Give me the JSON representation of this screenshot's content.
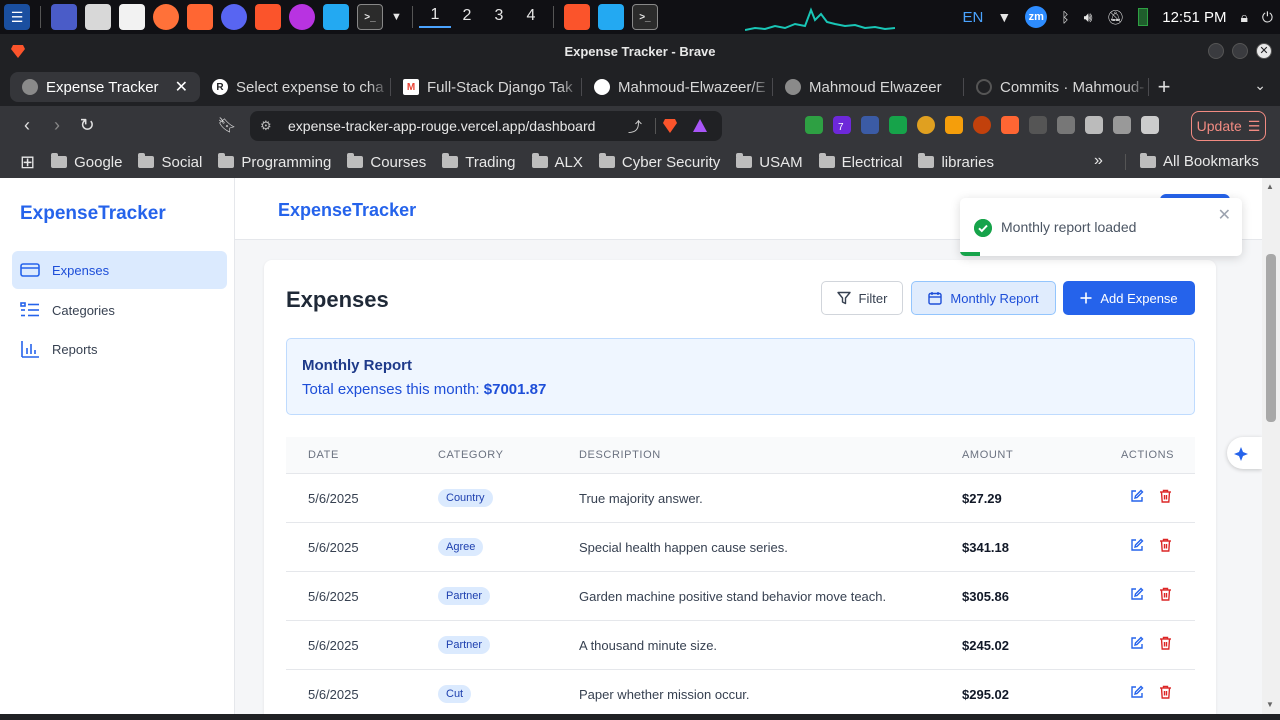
{
  "taskbar": {
    "workspaces": [
      "1",
      "2",
      "3",
      "4"
    ],
    "active_workspace": "1",
    "language": "EN",
    "zoom_label": "zm",
    "clock": "12:51 PM"
  },
  "browser": {
    "window_title": "Expense Tracker - Brave",
    "tabs": [
      {
        "label": "Expense Tracker",
        "active": true
      },
      {
        "label": "Select expense to cha"
      },
      {
        "label": "Full-Stack Django Tak"
      },
      {
        "label": "Mahmoud-Elwazeer/E"
      },
      {
        "label": "Mahmoud Elwazeer"
      },
      {
        "label": "Commits · Mahmoud-"
      }
    ],
    "url": "expense-tracker-app-rouge.vercel.app/dashboard",
    "update_label": "Update",
    "extension_badge": "7",
    "bookmarks": [
      "Google",
      "Social",
      "Programming",
      "Courses",
      "Trading",
      "ALX",
      "Cyber Security",
      "USAM",
      "Electrical",
      "libraries"
    ],
    "bookmarks_more": "»",
    "all_bookmarks": "All Bookmarks"
  },
  "sidebar": {
    "brand": "ExpenseTracker",
    "items": [
      {
        "label": "Expenses",
        "active": true
      },
      {
        "label": "Categories"
      },
      {
        "label": "Reports"
      }
    ]
  },
  "header": {
    "brand": "ExpenseTracker"
  },
  "main": {
    "title": "Expenses",
    "filter_label": "Filter",
    "monthly_report_label": "Monthly Report",
    "add_expense_label": "Add Expense",
    "report": {
      "title": "Monthly Report",
      "label": "Total expenses this month:",
      "value": "$7001.87"
    },
    "table": {
      "headers": [
        "DATE",
        "CATEGORY",
        "DESCRIPTION",
        "AMOUNT",
        "ACTIONS"
      ],
      "rows": [
        {
          "date": "5/6/2025",
          "category": "Country",
          "description": "True majority answer.",
          "amount": "$27.29"
        },
        {
          "date": "5/6/2025",
          "category": "Agree",
          "description": "Special health happen cause series.",
          "amount": "$341.18"
        },
        {
          "date": "5/6/2025",
          "category": "Partner",
          "description": "Garden machine positive stand behavior move teach.",
          "amount": "$305.86"
        },
        {
          "date": "5/6/2025",
          "category": "Partner",
          "description": "A thousand minute size.",
          "amount": "$245.02"
        },
        {
          "date": "5/6/2025",
          "category": "Cut",
          "description": "Paper whether mission occur.",
          "amount": "$295.02"
        }
      ]
    }
  },
  "toast": {
    "message": "Monthly report loaded",
    "progress": 0.07
  },
  "colors": {
    "accent": "#2563eb",
    "success": "#16a34a",
    "danger": "#dc2626"
  }
}
